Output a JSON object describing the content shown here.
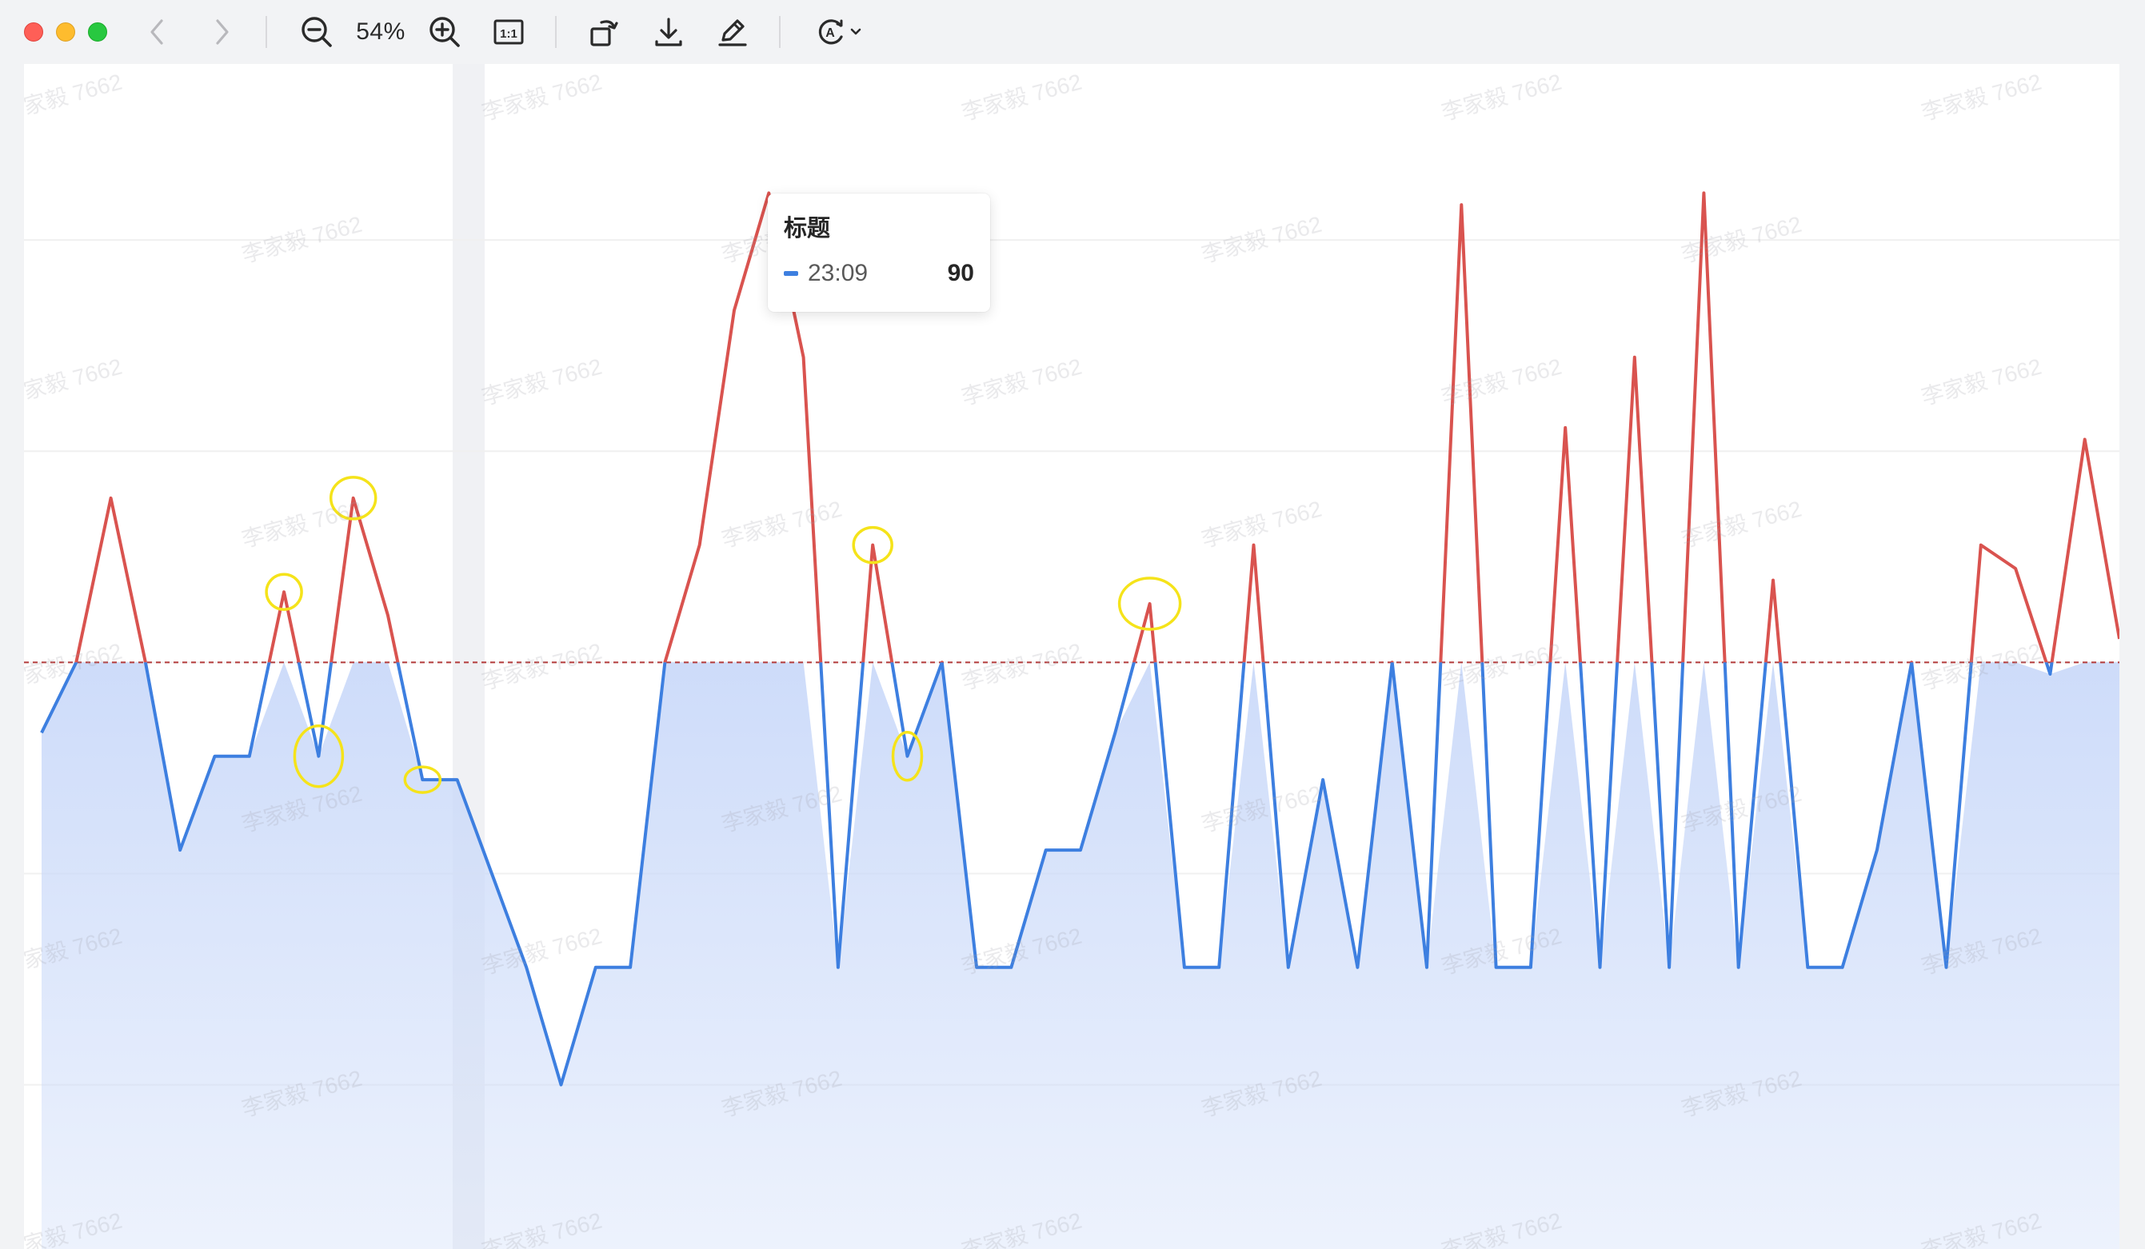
{
  "toolbar": {
    "zoom_label": "54%",
    "icons": [
      "chevron-left-icon",
      "chevron-right-icon",
      "zoom-out-icon",
      "zoom-in-icon",
      "actual-size-icon",
      "rotate-icon",
      "download-icon",
      "pencil-icon",
      "markup-icon",
      "chevron-down-icon"
    ],
    "actual_size_label": "1:1"
  },
  "watermark_text": "李家毅 7662",
  "tooltip": {
    "title": "标题",
    "series_time": "23:09",
    "value": "90"
  },
  "colors": {
    "above_threshold": "#d9534f",
    "below_threshold": "#3d7fe0",
    "area_fill": "#cddcfa",
    "threshold_line": "#b33a3a",
    "highlight_circle": "#f5e31a"
  },
  "chart_data": {
    "type": "line",
    "title": "",
    "threshold": 100,
    "ylim": [
      0,
      202
    ],
    "grid": true,
    "series": [
      {
        "name": "",
        "values": [
          [
            0,
            88
          ],
          [
            1,
            100
          ],
          [
            2,
            128
          ],
          [
            3,
            100
          ],
          [
            4,
            68
          ],
          [
            5,
            84
          ],
          [
            6,
            84
          ],
          [
            7,
            112
          ],
          [
            8,
            84
          ],
          [
            9,
            128
          ],
          [
            10,
            108
          ],
          [
            11,
            80
          ],
          [
            12,
            80
          ],
          [
            13,
            64
          ],
          [
            14,
            48
          ],
          [
            15,
            28
          ],
          [
            16,
            48
          ],
          [
            17,
            48
          ],
          [
            18,
            100
          ],
          [
            19,
            120
          ],
          [
            20,
            160
          ],
          [
            21,
            180
          ],
          [
            22,
            152
          ],
          [
            23,
            48
          ],
          [
            24,
            120
          ],
          [
            25,
            84
          ],
          [
            26,
            100
          ],
          [
            27,
            48
          ],
          [
            28,
            48
          ],
          [
            29,
            68
          ],
          [
            30,
            68
          ],
          [
            31,
            88
          ],
          [
            32,
            110
          ],
          [
            33,
            48
          ],
          [
            34,
            48
          ],
          [
            35,
            120
          ],
          [
            36,
            48
          ],
          [
            37,
            80
          ],
          [
            38,
            48
          ],
          [
            39,
            100
          ],
          [
            40,
            48
          ],
          [
            41,
            178
          ],
          [
            42,
            48
          ],
          [
            43,
            48
          ],
          [
            44,
            140
          ],
          [
            45,
            48
          ],
          [
            46,
            152
          ],
          [
            47,
            48
          ],
          [
            48,
            180
          ],
          [
            49,
            48
          ],
          [
            50,
            114
          ],
          [
            51,
            48
          ],
          [
            52,
            48
          ],
          [
            53,
            68
          ],
          [
            54,
            100
          ],
          [
            55,
            48
          ],
          [
            56,
            120
          ],
          [
            57,
            116
          ],
          [
            58,
            98
          ],
          [
            59,
            138
          ],
          [
            60,
            104
          ]
        ]
      }
    ],
    "highlight_indices": [
      7,
      8,
      9,
      11,
      24,
      25,
      32
    ]
  }
}
